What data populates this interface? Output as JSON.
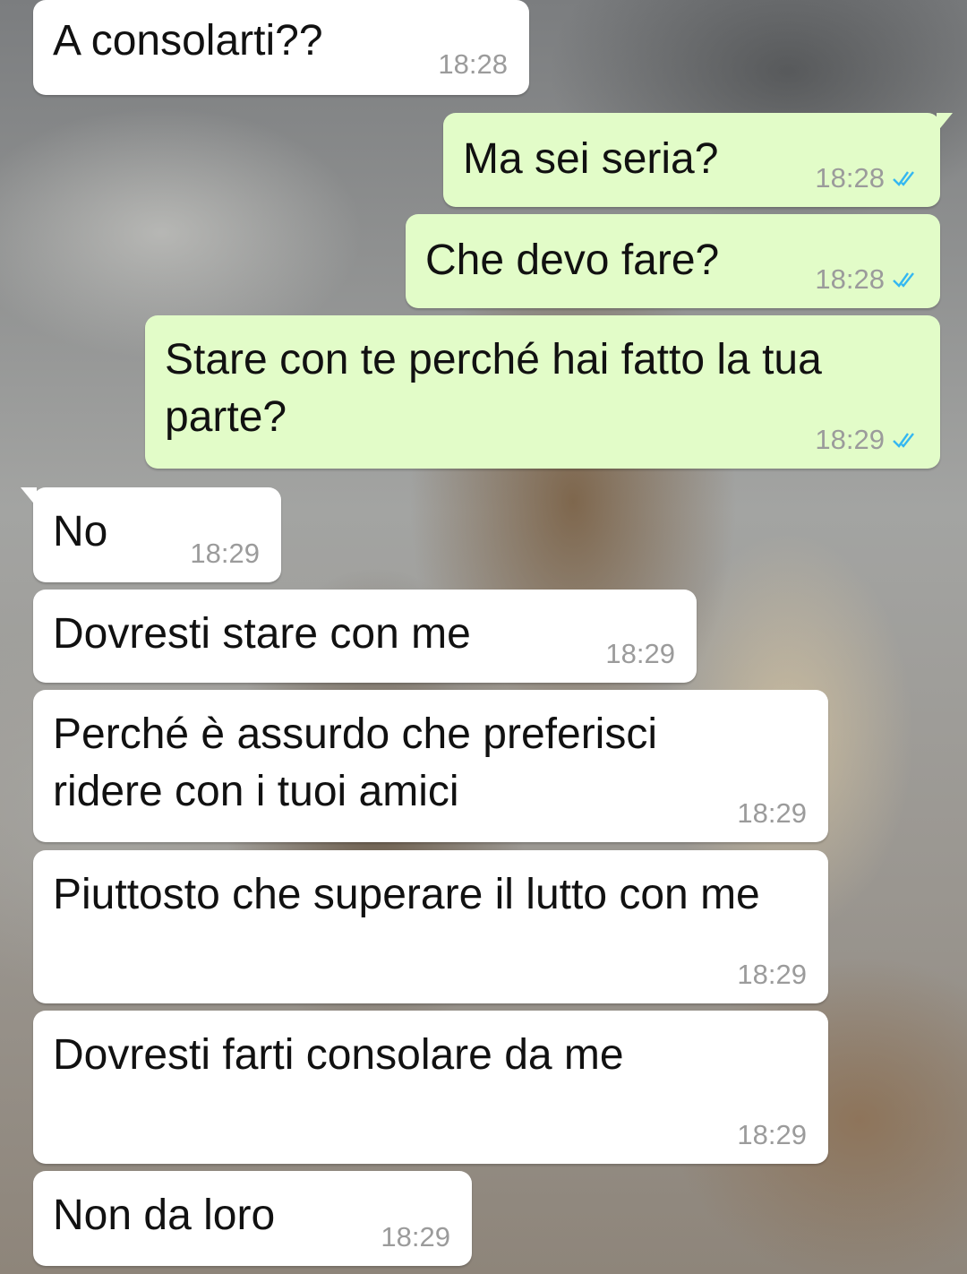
{
  "colors": {
    "incoming_bubble": "#ffffff",
    "outgoing_bubble": "#e2fcc8",
    "read_ticks": "#34b7f1",
    "timestamp": "#9b9b9b"
  },
  "messages": [
    {
      "direction": "in",
      "text": "A consolarti??",
      "time": "18:28"
    },
    {
      "direction": "out",
      "text": "Ma sei seria?",
      "time": "18:28",
      "status": "read"
    },
    {
      "direction": "out",
      "text": "Che devo fare?",
      "time": "18:28",
      "status": "read"
    },
    {
      "direction": "out",
      "text": "Stare con te perché hai fatto la tua parte?",
      "time": "18:29",
      "status": "read"
    },
    {
      "direction": "in",
      "text": "No",
      "time": "18:29"
    },
    {
      "direction": "in",
      "text": "Dovresti stare con me",
      "time": "18:29"
    },
    {
      "direction": "in",
      "text": "Perché è assurdo che preferisci ridere con i tuoi amici",
      "time": "18:29"
    },
    {
      "direction": "in",
      "text": "Piuttosto che superare il lutto con me",
      "time": "18:29"
    },
    {
      "direction": "in",
      "text": "Dovresti farti consolare da me",
      "time": "18:29"
    },
    {
      "direction": "in",
      "text": "Non da loro",
      "time": "18:29"
    }
  ],
  "icons": {
    "read_receipt": "double-check-icon"
  }
}
